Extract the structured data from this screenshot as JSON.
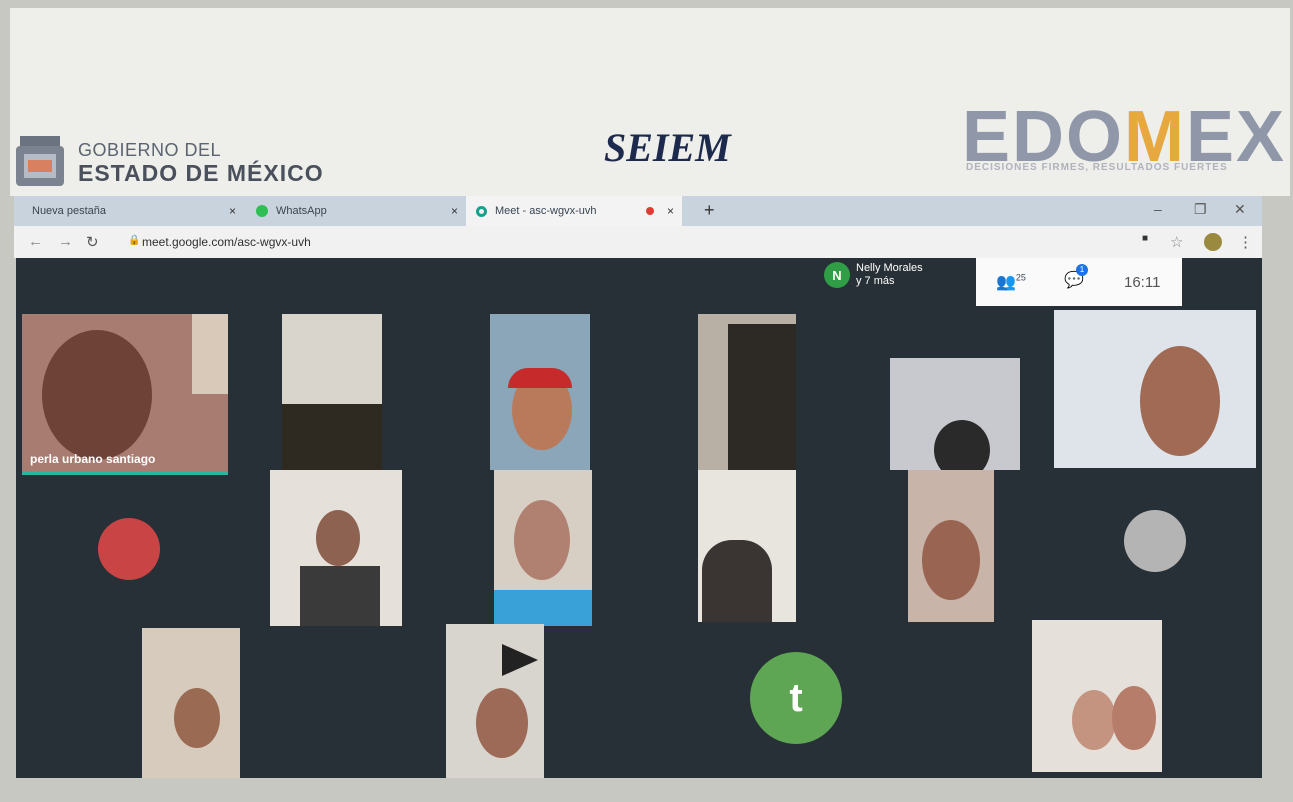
{
  "banner": {
    "gov_line1": "GOBIERNO DEL",
    "gov_line2": "ESTADO DE MÉXICO",
    "center_title": "SEIEM",
    "right_brand_a": "EDO",
    "right_brand_m": "M",
    "right_brand_b": "EX",
    "right_tagline": "DECISIONES FIRMES, RESULTADOS FUERTES"
  },
  "browser": {
    "tabs": [
      {
        "label": "Nueva pestaña"
      },
      {
        "label": "WhatsApp"
      },
      {
        "label": "Meet - asc-wgvx-uvh"
      }
    ],
    "url": "meet.google.com/asc-wgvx-uvh",
    "new_tab_symbol": "+",
    "close_symbol": "×"
  },
  "meet": {
    "presenter_initial": "N",
    "presenter_name": "Nelly Morales",
    "presenter_extra": "y 7 más",
    "participants_count": "25",
    "chat_badge": "1",
    "time": "16:11",
    "named_tile": "perla urbano santiago",
    "avatar_letter": "t"
  },
  "colors": {
    "meet_bg": "#273036",
    "presenter_green": "#2f9e46",
    "avatar_green": "#5ea554"
  }
}
